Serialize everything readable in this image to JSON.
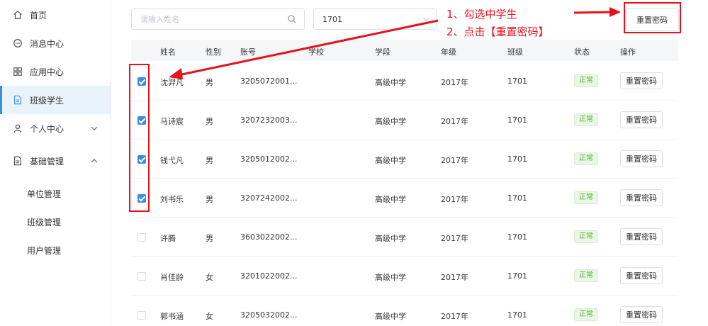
{
  "sidebar": {
    "items": [
      {
        "label": "首页",
        "icon": "home-icon"
      },
      {
        "label": "消息中心",
        "icon": "chat-icon"
      },
      {
        "label": "应用中心",
        "icon": "grid-icon"
      },
      {
        "label": "班级学生",
        "icon": "document-icon",
        "active": true
      },
      {
        "label": "个人中心",
        "icon": "user-icon",
        "expandable": "collapsed"
      },
      {
        "label": "基础管理",
        "icon": "file-icon",
        "expandable": "expanded"
      }
    ],
    "sub_items": [
      {
        "label": "单位管理"
      },
      {
        "label": "班级管理"
      },
      {
        "label": "用户管理"
      }
    ]
  },
  "toolbar": {
    "search_placeholder": "请输入姓名",
    "class_select_value": "1701",
    "reset_button_label": "重置密码"
  },
  "table": {
    "columns": [
      "姓名",
      "性别",
      "账号",
      "学校",
      "学段",
      "年级",
      "班级",
      "状态",
      "操作"
    ],
    "rows": [
      {
        "checked": true,
        "name": "沈羿凡",
        "gender": "男",
        "account": "3205072001...",
        "school": "",
        "stage": "高级中学",
        "grade": "2017年",
        "class": "1701",
        "status": "正常",
        "action": "重置密码"
      },
      {
        "checked": true,
        "name": "马诗宸",
        "gender": "男",
        "account": "3207232003...",
        "school": "",
        "stage": "高级中学",
        "grade": "2017年",
        "class": "1701",
        "status": "正常",
        "action": "重置密码"
      },
      {
        "checked": true,
        "name": "钱弋凡",
        "gender": "男",
        "account": "3205012002...",
        "school": "",
        "stage": "高级中学",
        "grade": "2017年",
        "class": "1701",
        "status": "正常",
        "action": "重置密码"
      },
      {
        "checked": true,
        "name": "刘书乐",
        "gender": "男",
        "account": "3207242002...",
        "school": "",
        "stage": "高级中学",
        "grade": "2017年",
        "class": "1701",
        "status": "正常",
        "action": "重置密码"
      },
      {
        "checked": false,
        "name": "许腾",
        "gender": "男",
        "account": "3603022002...",
        "school": "",
        "stage": "高级中学",
        "grade": "2017年",
        "class": "1701",
        "status": "正常",
        "action": "重置密码"
      },
      {
        "checked": false,
        "name": "肖佳龄",
        "gender": "女",
        "account": "3201022002...",
        "school": "",
        "stage": "高级中学",
        "grade": "2017年",
        "class": "1701",
        "status": "正常",
        "action": "重置密码"
      },
      {
        "checked": false,
        "name": "郭书涵",
        "gender": "女",
        "account": "3205032002...",
        "school": "",
        "stage": "高级中学",
        "grade": "2017年",
        "class": "1701",
        "status": "正常",
        "action": "重置密码"
      }
    ]
  },
  "annotation": {
    "step1": "1、勾选中学生",
    "step2": "2、点击【重置密码】"
  },
  "colors": {
    "accent": "#3a8ee6",
    "active_bg": "#e8f3fb",
    "status_green": "#52b033",
    "annotation_red": "#e8101a"
  }
}
